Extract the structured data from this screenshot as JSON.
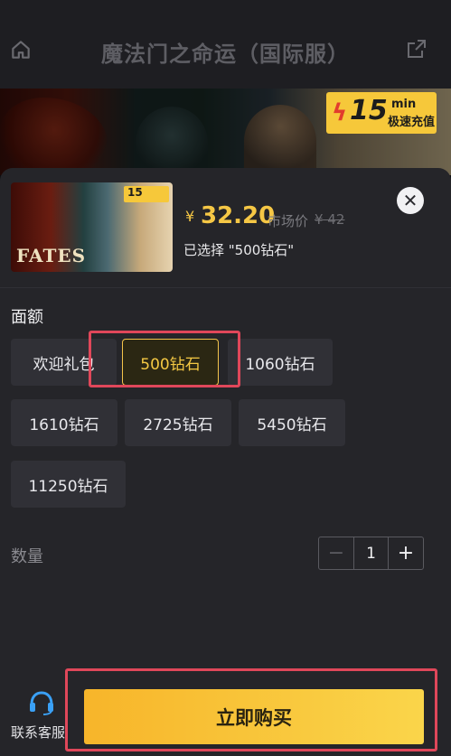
{
  "header": {
    "title": "魔法门之命运（国际服）",
    "home_icon": "home-icon",
    "share_icon": "share-icon"
  },
  "banner": {
    "badge": {
      "number": "15",
      "unit": "min",
      "text": "极速充值"
    }
  },
  "product": {
    "thumbnail_title": "FATES",
    "thumbnail_badge": "15",
    "currency_symbol": "¥",
    "price": "32.20",
    "market_label": "市场价",
    "market_price": "¥ 42",
    "selected_text": "已选择 \"500钻石\""
  },
  "denomination": {
    "label": "面额",
    "options": [
      "欢迎礼包",
      "500钻石",
      "1060钻石",
      "1610钻石",
      "2725钻石",
      "5450钻石",
      "11250钻石"
    ],
    "selected": "500钻石"
  },
  "quantity": {
    "label": "数量",
    "value": "1",
    "minus": "−",
    "plus": "+"
  },
  "footer": {
    "customer_service_label": "联系客服",
    "buy_label": "立即购买"
  },
  "colors": {
    "accent": "#f5c745",
    "highlight_box": "#e0475a",
    "sheet_bg": "#252529"
  }
}
